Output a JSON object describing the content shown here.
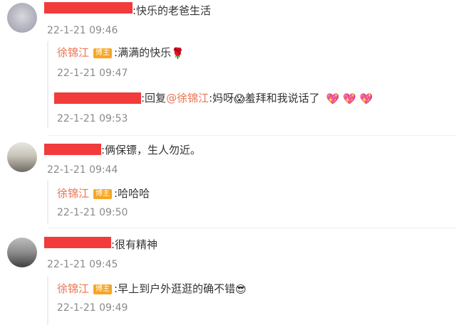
{
  "comments": [
    {
      "text": ":快乐的老爸生活",
      "time": "22-1-21 09:46",
      "replies": [
        {
          "author": "徐锦江",
          "badge": "博主",
          "text": ":满满的快乐",
          "emoji": "🌹",
          "time": "22-1-21 09:47"
        },
        {
          "reply_prefix": ":回复",
          "mention": "@徐锦江",
          "text_a": ":妈呀",
          "emoji_a": "😱",
          "text_b": "羞拜和我说话了",
          "emoji_tail": "💖 💖 💖",
          "time": "22-1-21 09:53"
        }
      ]
    },
    {
      "text": ":俩保镖，生人勿近。",
      "time": "22-1-21 09:44",
      "replies": [
        {
          "author": "徐锦江",
          "badge": "博主",
          "text": ":哈哈哈",
          "time": "22-1-21 09:50"
        }
      ]
    },
    {
      "text": ":很有精神",
      "time": "22-1-21 09:45",
      "replies": [
        {
          "author": "徐锦江",
          "badge": "博主",
          "text": ":早上到户外逛逛的确不错",
          "emoji": "😎",
          "time": "22-1-21 09:49"
        }
      ]
    }
  ]
}
